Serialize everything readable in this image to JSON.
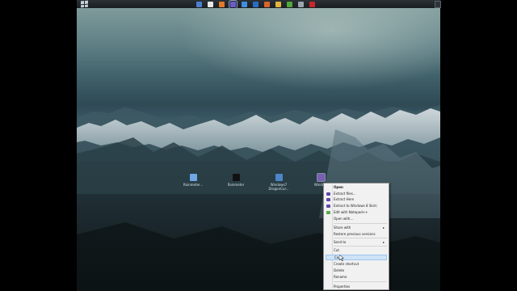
{
  "taskbar": {
    "start_icon": "windows-logo",
    "icons": [
      {
        "name": "explorer-icon",
        "color": "#4a7fd0"
      },
      {
        "name": "media-icon",
        "color": "#e8e8e8"
      },
      {
        "name": "firefox-icon",
        "color": "#e07a2a"
      },
      {
        "name": "app-icon",
        "color": "#6b5cc9"
      },
      {
        "name": "ie-icon",
        "color": "#3f8fe0"
      },
      {
        "name": "outlook-icon",
        "color": "#2a6cc4"
      },
      {
        "name": "office-icon",
        "color": "#d9632a"
      },
      {
        "name": "folder-icon",
        "color": "#e6b33a"
      },
      {
        "name": "utorrent-icon",
        "color": "#4fa83a"
      },
      {
        "name": "window-icon",
        "color": "#9aa4ae"
      },
      {
        "name": "acrobat-icon",
        "color": "#c8262a"
      }
    ],
    "active_index": 3
  },
  "desktop_icons": [
    {
      "label": "Rainmeter...",
      "color": "#6fa7e6"
    },
    {
      "label": "Rainmeter",
      "color": "#111111"
    },
    {
      "label": "Windows7 DragonCur...",
      "color": "#4d86c8"
    },
    {
      "label": "Windo...",
      "color": "#7a5fb0"
    }
  ],
  "context_menu": {
    "items": [
      {
        "label": "Open",
        "bold": true
      },
      {
        "label": "Extract files..."
      },
      {
        "label": "Extract Here"
      },
      {
        "label": "Extract to Windows 8 Skin\\"
      },
      {
        "label": "Edit with Notepad++"
      },
      {
        "label": "Open with..."
      },
      {
        "label": "Share with",
        "submenu": true
      },
      {
        "label": "Restore previous versions"
      },
      {
        "label": "Send to",
        "submenu": true
      },
      {
        "label": "Cut"
      },
      {
        "label": "Copy",
        "hover": true
      },
      {
        "label": "Create shortcut"
      },
      {
        "label": "Delete"
      },
      {
        "label": "Rename"
      },
      {
        "label": "Properties"
      }
    ],
    "submenu_arrow": "▸",
    "colors": {
      "background": "#f1f1f1",
      "hover": "#cfe3f7"
    }
  }
}
